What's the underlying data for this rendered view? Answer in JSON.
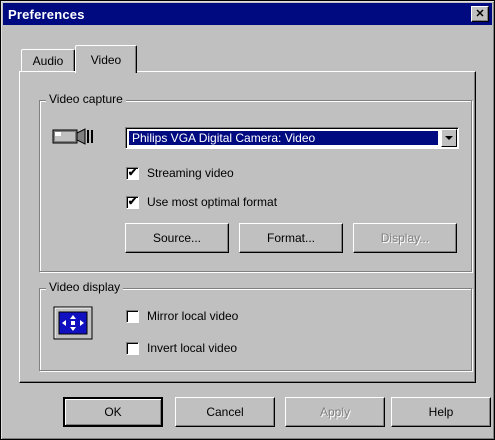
{
  "window": {
    "title": "Preferences",
    "close": "✕"
  },
  "tabs": [
    {
      "label": "Audio"
    },
    {
      "label": "Video"
    }
  ],
  "video_capture": {
    "legend": "Video capture",
    "device": "Philips VGA Digital Camera: Video",
    "streaming": {
      "label": "Streaming video",
      "checked": true,
      "mark": "✔"
    },
    "optimal": {
      "label": "Use most optimal format",
      "checked": true,
      "mark": "✔"
    },
    "buttons": {
      "source": "Source...",
      "format": "Format...",
      "display": "Display..."
    }
  },
  "video_display": {
    "legend": "Video display",
    "mirror": {
      "label": "Mirror local video",
      "checked": false
    },
    "invert": {
      "label": "Invert local video",
      "checked": false
    }
  },
  "footer": {
    "ok": "OK",
    "cancel": "Cancel",
    "apply": "Apply",
    "help": "Help"
  }
}
